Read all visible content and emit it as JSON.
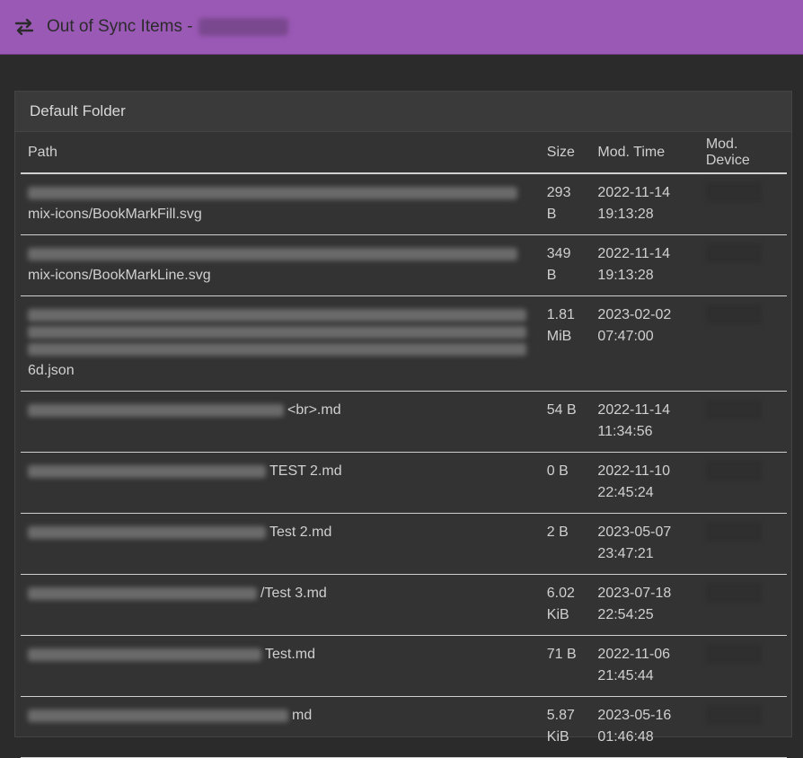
{
  "header": {
    "title": "Out of Sync Items -",
    "icon": "sync-arrows-icon",
    "colors": {
      "bar": "#9b59b6"
    }
  },
  "folder": {
    "label": "Default Folder"
  },
  "table": {
    "columns": [
      "Path",
      "Size",
      "Mod. Time",
      "Mod. Device"
    ],
    "rows": [
      {
        "path_prefix": "",
        "path_suffix": "mix-icons/BookMarkFill.svg",
        "size": "293 B",
        "date": "2022-11-14",
        "time": "19:13:28"
      },
      {
        "path_prefix": "",
        "path_suffix": "mix-icons/BookMarkLine.svg",
        "size": "349 B",
        "date": "2022-11-14",
        "time": "19:13:28"
      },
      {
        "path_prefix": "",
        "path_suffix": "6d.json",
        "size": "1.81 MiB",
        "date": "2023-02-02",
        "time": "07:47:00"
      },
      {
        "path_prefix": "",
        "path_suffix": "<br>.md",
        "size": "54 B",
        "date": "2022-11-14",
        "time": "11:34:56"
      },
      {
        "path_prefix": "",
        "path_suffix": "TEST 2.md",
        "size": "0 B",
        "date": "2022-11-10",
        "time": "22:45:24"
      },
      {
        "path_prefix": "",
        "path_suffix": "Test 2.md",
        "size": "2 B",
        "date": "2023-05-07",
        "time": "23:47:21"
      },
      {
        "path_prefix": "",
        "path_suffix": "/Test 3.md",
        "size": "6.02 KiB",
        "date": "2023-07-18",
        "time": "22:54:25"
      },
      {
        "path_prefix": "",
        "path_suffix": "Test.md",
        "size": "71 B",
        "date": "2022-11-06",
        "time": "21:45:44"
      },
      {
        "path_prefix": "",
        "path_suffix": "md",
        "size": "5.87 KiB",
        "date": "2023-05-16",
        "time": "01:46:48"
      }
    ]
  }
}
